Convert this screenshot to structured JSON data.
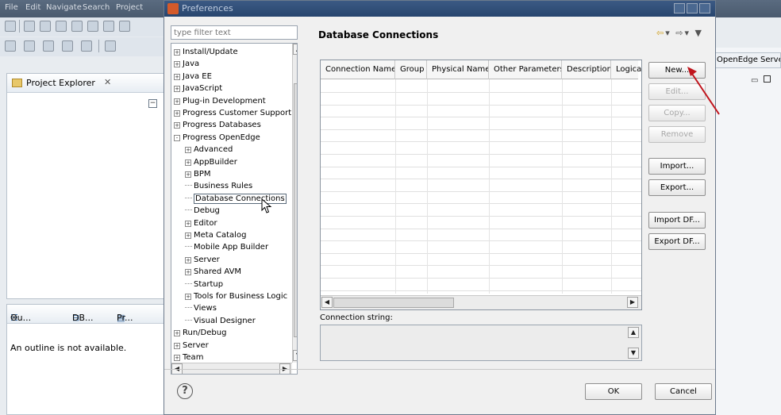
{
  "eclipse": {
    "menu": [
      "File",
      "Edit",
      "Navigate",
      "Search",
      "Project"
    ],
    "project_explorer": {
      "title": "Project Explorer"
    },
    "outline": {
      "tabs": [
        "Ou...",
        "DB...",
        "Pr..."
      ],
      "message": "An outline is not available."
    },
    "right_tab": "OpenEdge Server"
  },
  "dialog": {
    "title": "Preferences",
    "filter_placeholder": "type filter text",
    "page_title": "Database Connections",
    "tree": [
      {
        "label": "Install/Update",
        "level": 0,
        "expander": "+"
      },
      {
        "label": "Java",
        "level": 0,
        "expander": "+"
      },
      {
        "label": "Java EE",
        "level": 0,
        "expander": "+"
      },
      {
        "label": "JavaScript",
        "level": 0,
        "expander": "+"
      },
      {
        "label": "Plug-in Development",
        "level": 0,
        "expander": "+"
      },
      {
        "label": "Progress Customer Support",
        "level": 0,
        "expander": "+"
      },
      {
        "label": "Progress Databases",
        "level": 0,
        "expander": "+"
      },
      {
        "label": "Progress OpenEdge",
        "level": 0,
        "expander": "-"
      },
      {
        "label": "Advanced",
        "level": 1,
        "expander": "+"
      },
      {
        "label": "AppBuilder",
        "level": 1,
        "expander": "+"
      },
      {
        "label": "BPM",
        "level": 1,
        "expander": "+"
      },
      {
        "label": "Business Rules",
        "level": 1,
        "expander": ""
      },
      {
        "label": "Database Connections",
        "level": 1,
        "expander": "",
        "selected": true
      },
      {
        "label": "Debug",
        "level": 1,
        "expander": ""
      },
      {
        "label": "Editor",
        "level": 1,
        "expander": "+"
      },
      {
        "label": "Meta Catalog",
        "level": 1,
        "expander": "+"
      },
      {
        "label": "Mobile App Builder",
        "level": 1,
        "expander": ""
      },
      {
        "label": "Server",
        "level": 1,
        "expander": "+"
      },
      {
        "label": "Shared AVM",
        "level": 1,
        "expander": "+"
      },
      {
        "label": "Startup",
        "level": 1,
        "expander": ""
      },
      {
        "label": "Tools for Business Logic",
        "level": 1,
        "expander": "+"
      },
      {
        "label": "Views",
        "level": 1,
        "expander": ""
      },
      {
        "label": "Visual Designer",
        "level": 1,
        "expander": ""
      },
      {
        "label": "Run/Debug",
        "level": 0,
        "expander": "+"
      },
      {
        "label": "Server",
        "level": 0,
        "expander": "+"
      },
      {
        "label": "Team",
        "level": 0,
        "expander": "+"
      }
    ],
    "table": {
      "columns": [
        "Connection Name",
        "Group",
        "Physical Name",
        "Other Parameters",
        "Description",
        "Logica"
      ]
    },
    "buttons": {
      "new": "New...",
      "edit": "Edit...",
      "copy": "Copy...",
      "remove": "Remove",
      "import": "Import...",
      "export": "Export...",
      "import_df": "Import DF...",
      "export_df": "Export DF..."
    },
    "connection_string_label": "Connection string:",
    "ok": "OK",
    "cancel": "Cancel",
    "help_symbol": "?"
  },
  "colors": {
    "title_bar": "#27456e",
    "annotation_arrow": "#c0141c"
  }
}
